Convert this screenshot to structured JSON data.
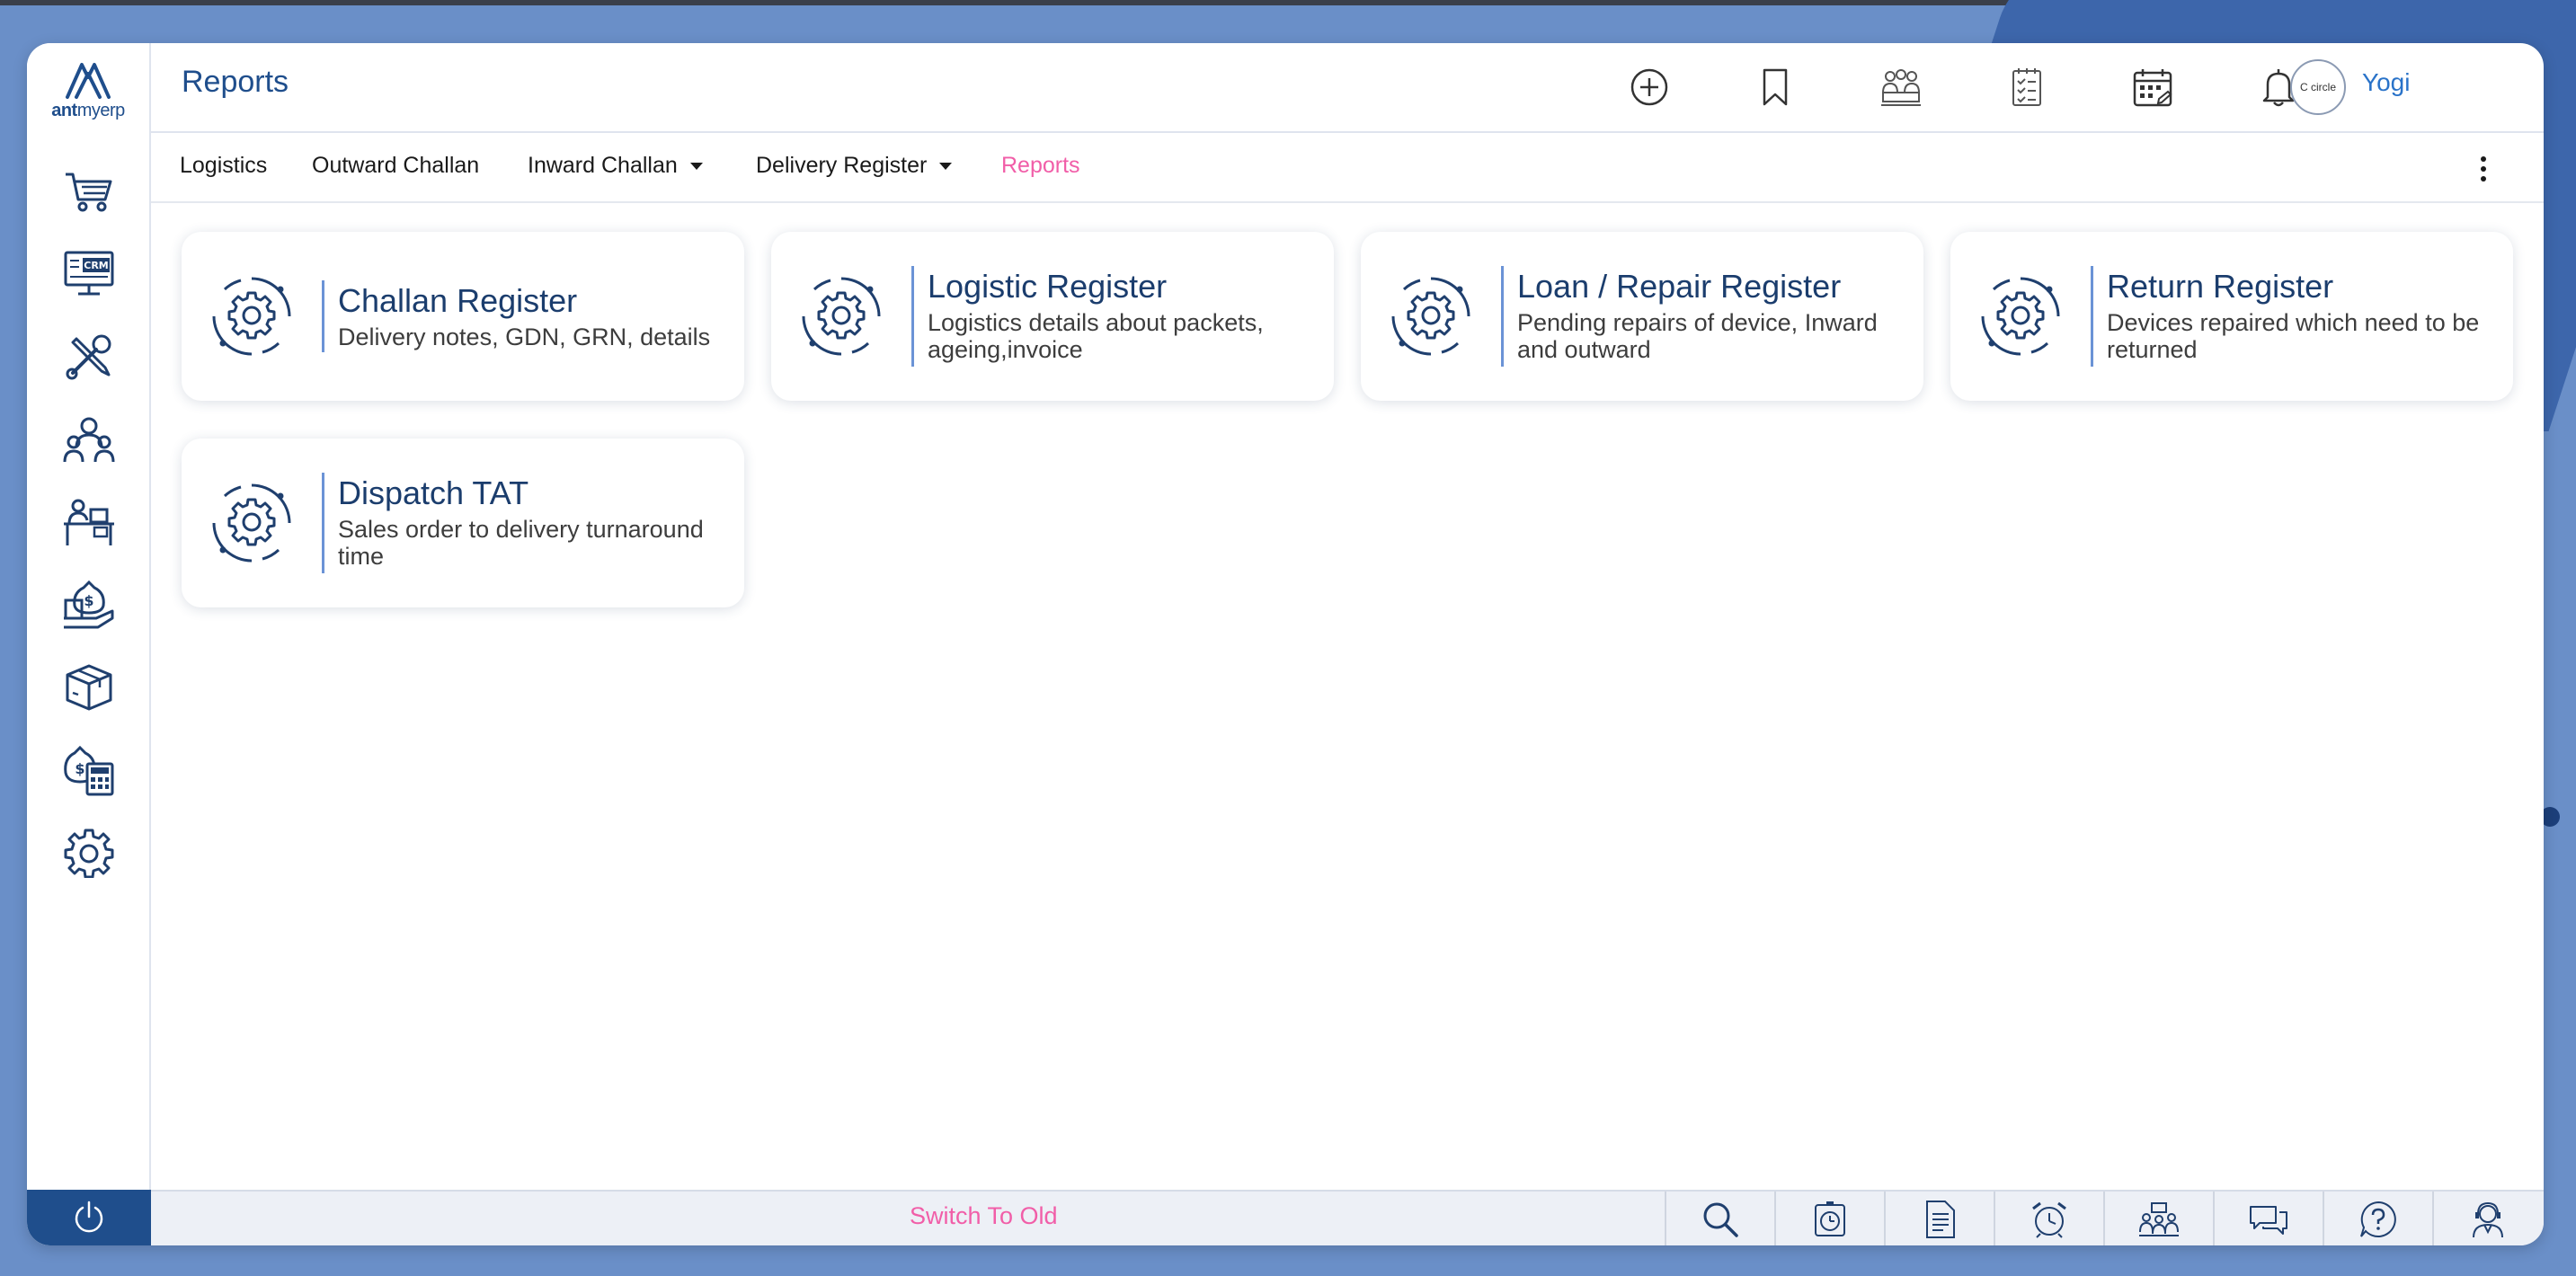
{
  "app": {
    "logo_text_bold": "ant",
    "logo_text_rest": "myerp"
  },
  "header": {
    "title": "Reports",
    "user_name": "Yogi",
    "avatar_text": "C circle"
  },
  "sidebar": {
    "items": [
      {
        "icon": "cart-icon"
      },
      {
        "icon": "crm-monitor-icon",
        "badge": "CRM"
      },
      {
        "icon": "tools-icon"
      },
      {
        "icon": "people-icon"
      },
      {
        "icon": "desk-icon"
      },
      {
        "icon": "finance-icon"
      },
      {
        "icon": "package-icon"
      },
      {
        "icon": "money-calculator-icon"
      },
      {
        "icon": "gear-icon"
      }
    ],
    "power_icon": "power-icon"
  },
  "header_icons": [
    "plus-circle-icon",
    "bookmark-icon",
    "team-icon",
    "checklist-icon",
    "calendar-icon",
    "bell-icon"
  ],
  "subnav": {
    "items": [
      {
        "label": "Logistics"
      },
      {
        "label": "Outward Challan"
      },
      {
        "label": "Inward Challan"
      },
      {
        "label": "Delivery Register"
      },
      {
        "label": "Reports"
      }
    ],
    "active": "Reports"
  },
  "cards": [
    {
      "title": "Challan Register",
      "desc": "Delivery notes, GDN, GRN, details"
    },
    {
      "title": "Logistic Register",
      "desc": "Logistics details about packets, ageing,invoice"
    },
    {
      "title": "Loan / Repair Register",
      "desc": "Pending repairs of device, Inward and outward"
    },
    {
      "title": "Return Register",
      "desc": "Devices repaired which need to be returned"
    },
    {
      "title": "Dispatch TAT",
      "desc": "Sales order to delivery turnaround time"
    }
  ],
  "footer": {
    "switch_label": "Switch To Old",
    "icons": [
      "search-icon",
      "stopwatch-icon",
      "document-icon",
      "alarm-icon",
      "meeting-icon",
      "chat-icon",
      "help-icon",
      "support-agent-icon"
    ]
  },
  "colors": {
    "brand": "#1f4e8c",
    "accent_pink": "#f15ea8",
    "link_blue": "#2a73c9",
    "background": "#6a8fc8"
  }
}
